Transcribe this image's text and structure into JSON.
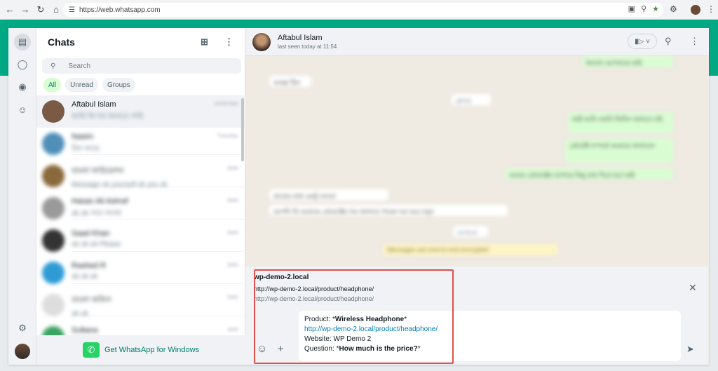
{
  "browser": {
    "url": "https://web.whatsapp.com"
  },
  "sidebar": {
    "title": "Chats",
    "search_placeholder": "Search",
    "filters": [
      "All",
      "Unread",
      "Groups"
    ],
    "chats": [
      {
        "name": "Aftabul Islam",
        "preview": "আমি কি দাম জানতে পারি",
        "time": "yesterday",
        "avatar": "#7a5a44"
      },
      {
        "name": "Nasim",
        "preview": "ঠিক আছে",
        "time": "Tuesday",
        "avatar": "#4f8fb8"
      },
      {
        "name": "বাংলা ফাউন্ডেশন",
        "preview": "Message ok yourself ok yes ok",
        "time": "date",
        "avatar": "#8a6a3c"
      },
      {
        "name": "Hasan Ali Ashraf",
        "preview": "ok ok সময় অবস্থা",
        "time": "date",
        "avatar": "#9a9a9a"
      },
      {
        "name": "Saad Khan",
        "preview": "ok ok ok Please",
        "time": "date",
        "avatar": "#333333"
      },
      {
        "name": "Rashed R",
        "preview": "ok ok ok",
        "time": "date",
        "avatar": "#2f9bd6"
      },
      {
        "name": "বাংলা অফিস",
        "preview": "ok ok",
        "time": "date",
        "avatar": "#dddddd"
      },
      {
        "name": "Sultana",
        "preview": "",
        "time": "date",
        "avatar": "#3aa561"
      }
    ],
    "get_windows": "Get WhatsApp for Windows"
  },
  "chat": {
    "name": "Aftabul Islam",
    "status": "last seen today at 11:54"
  },
  "compose": {
    "preview_title": "wp-demo-2.local",
    "preview_url": "http://wp-demo-2.local/product/headphone/",
    "preview_link": "http://wp-demo-2.local/product/headphone/",
    "line1_prefix": "Product: *",
    "line1_bold": "Wireless Headphone",
    "line1_suffix": "*",
    "line2": "http://wp-demo-2.local/product/headphone/",
    "line3": "Website: WP Demo 2",
    "line4_prefix": "Question: *",
    "line4_bold": "How much is the price?",
    "line4_suffix": "*"
  },
  "colors": {
    "accent": "#00a884",
    "highlight": "#e2504a"
  }
}
